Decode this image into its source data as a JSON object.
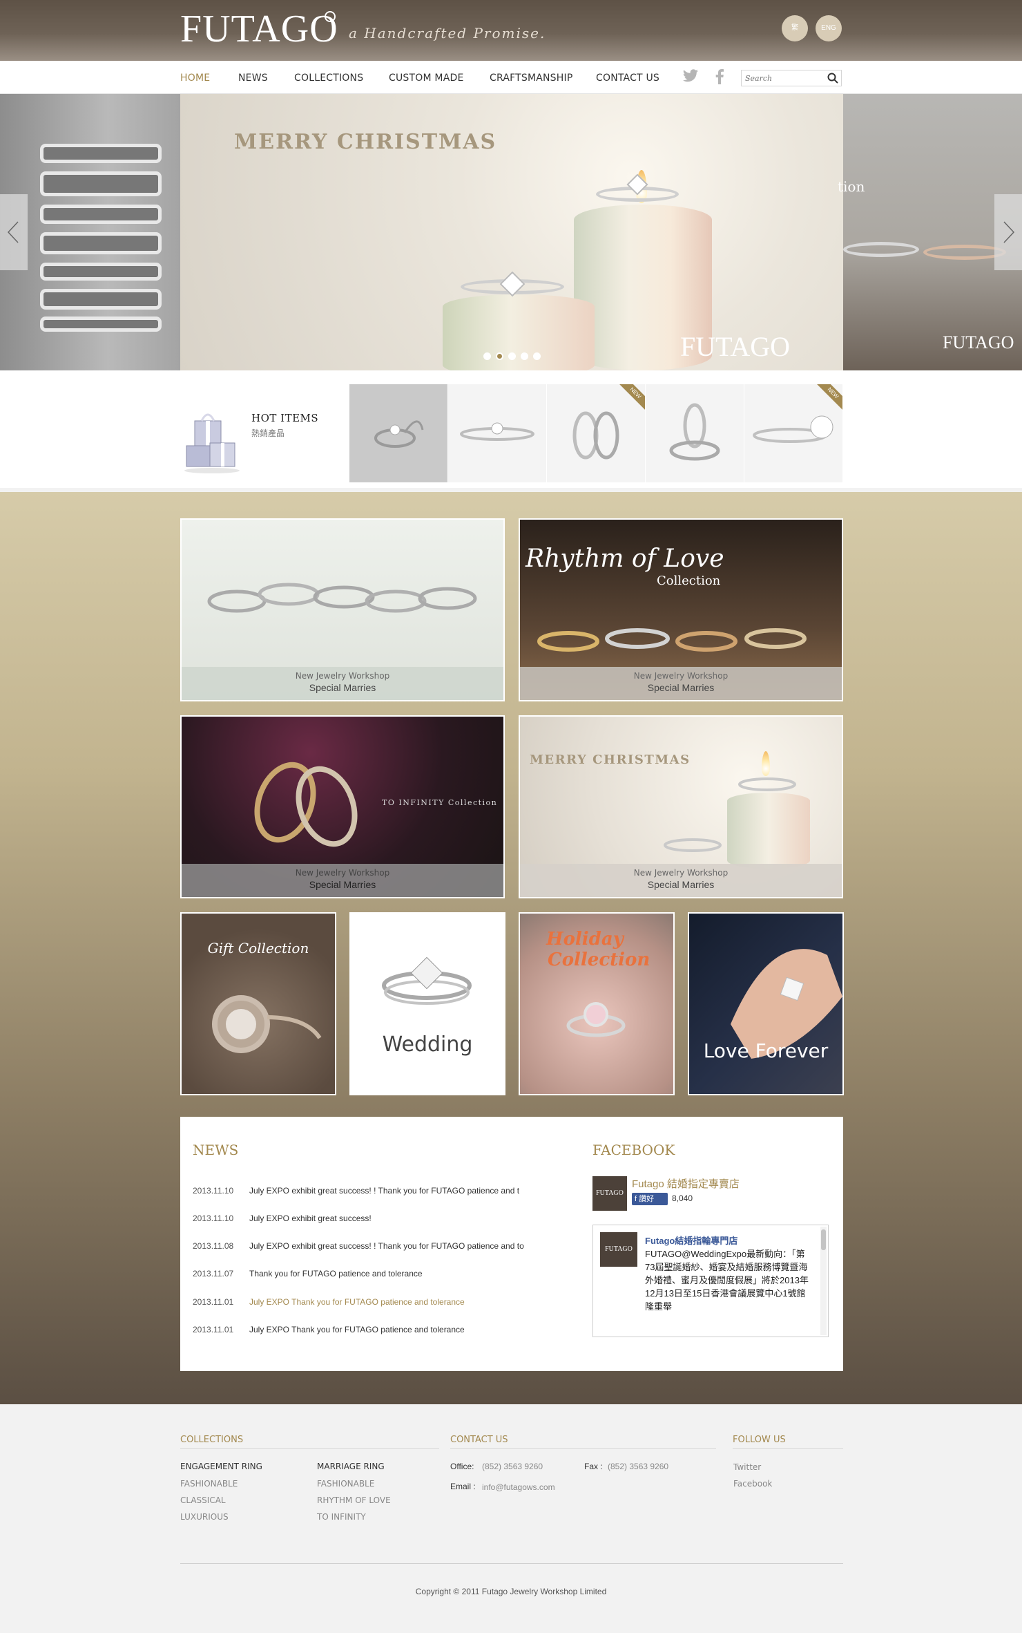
{
  "header": {
    "logo": "FUTAGO",
    "tagline": "a Handcrafted Promise.",
    "lang_tc": "繁",
    "lang_en": "ENG"
  },
  "nav": {
    "items": [
      "HOME",
      "NEWS",
      "COLLECTIONS",
      "CUSTOM MADE",
      "CRAFTSMANSHIP",
      "CONTACT US"
    ],
    "active": "HOME",
    "search_placeholder": "Search"
  },
  "hero": {
    "title": "MERRY CHRISTMAS",
    "brand": "FUTAGO",
    "right_text": "tion",
    "right_brand": "FUTAGO",
    "slide_count": 5,
    "active_slide": 2
  },
  "hot_items": {
    "title": "HOT ITEMS",
    "subtitle": "熱銷產品",
    "badge": "NEW",
    "thumbs_with_badge": [
      3,
      5
    ]
  },
  "tiles": {
    "caption_sub": "New Jewelry Workshop",
    "caption_main": "Special Marries",
    "rhythm_title": "Rhythm of Love",
    "rhythm_sub": "Collection",
    "infinity_title": "TO INFINITY Collection",
    "xmas_title": "MERRY CHRISTMAS",
    "gift": "Gift Collection",
    "wedding": "Wedding",
    "holiday_line1": "Holiday",
    "holiday_line2": "Collection",
    "love": "Love Forever"
  },
  "news": {
    "title": "NEWS",
    "items": [
      {
        "date": "2013.11.10",
        "text": "July EXPO exhibit great success! ! Thank you for FUTAGO patience and t"
      },
      {
        "date": "2013.11.10",
        "text": "July EXPO exhibit great success!"
      },
      {
        "date": "2013.11.08",
        "text": "July EXPO exhibit great success! ! Thank you for FUTAGO patience and to"
      },
      {
        "date": "2013.11.07",
        "text": "Thank you for FUTAGO patience and tolerance"
      },
      {
        "date": "2013.11.01",
        "text": "July EXPO Thank you for FUTAGO patience and tolerance"
      },
      {
        "date": "2013.11.01",
        "text": "July EXPO Thank you for FUTAGO patience and tolerance"
      }
    ]
  },
  "facebook": {
    "title": "FACEBOOK",
    "avatar": "FUTAGO",
    "page_name": "Futago 結婚指定專賣店",
    "like_label": "讚好",
    "like_count": "8,040",
    "post_name": "Futago結婚指輪專門店",
    "post_text": "FUTAGO@WeddingExpo最新動向：「第73屆聖誕婚紗、婚宴及結婚服務博覽暨海外婚禮、蜜月及優閒度假展」將於2013年12月13日至15日香港會議展覽中心1號館隆重舉"
  },
  "footer": {
    "collections_title": "COLLECTIONS",
    "engagement": "ENGAGEMENT RING",
    "engagement_items": [
      "FASHIONABLE",
      "CLASSICAL",
      "LUXURIOUS"
    ],
    "marriage": "MARRIAGE RING",
    "marriage_items": [
      "FASHIONABLE",
      "RHYTHM OF LOVE",
      "TO INFINITY"
    ],
    "contact_title": "CONTACT US",
    "office_label": "Office:",
    "office": "(852) 3563 9260",
    "fax_label": "Fax :",
    "fax": "(852) 3563 9260",
    "email_label": "Email :",
    "email": "info@futagows.com",
    "follow_title": "FOLLOW US",
    "follow_items": [
      "Twitter",
      "Facebook"
    ],
    "copyright": "Copyright © 2011 Futago Jewelry Workshop Limited"
  },
  "colors": {
    "accent": "#a3894f",
    "header_brown": "#6e6256",
    "facebook_blue": "#3b5998"
  }
}
